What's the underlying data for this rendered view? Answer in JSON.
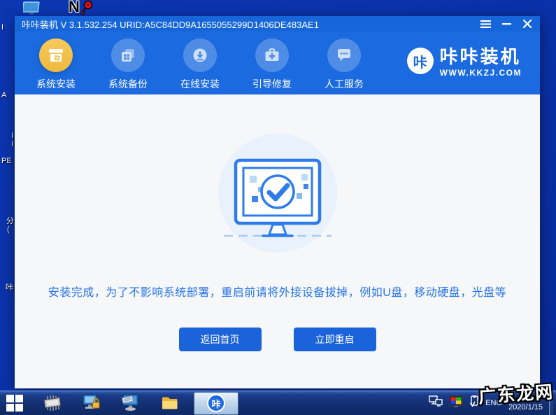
{
  "desktop": {
    "fragments": [
      "I",
      "A",
      "I",
      "I",
      "PE",
      "分",
      "(",
      "咔"
    ]
  },
  "window": {
    "titlebar": {
      "title": "咔咔装机 V 3.1.532.254 URID:A5C84DD9A1655055299D1406DE483AE1"
    },
    "nav": {
      "items": [
        {
          "label": "系统安装",
          "icon": "install-box-icon",
          "active": true
        },
        {
          "label": "系统备份",
          "icon": "backup-icon",
          "active": false
        },
        {
          "label": "在线安装",
          "icon": "download-icon",
          "active": false
        },
        {
          "label": "引导修复",
          "icon": "repair-kit-icon",
          "active": false
        },
        {
          "label": "人工服务",
          "icon": "chat-service-icon",
          "active": false
        }
      ],
      "logo": {
        "badge": "咔",
        "title": "咔咔装机",
        "url": "WWW.KKZJ.COM"
      }
    },
    "content": {
      "message": "安装完成，为了不影响系统部署，重启前请将外接设备拔掉，例如U盘，移动硬盘，光盘等",
      "home_button": "返回首页",
      "restart_button": "立即重启"
    }
  },
  "taskbar": {
    "kaka_badge": "咔",
    "tray": {
      "language": "ENG",
      "date": "2020/1/15"
    }
  },
  "watermark": "广东龙网",
  "colors": {
    "desktop_blue": "#0a31a8",
    "header_blue": "#1b6adf",
    "accent_gold": "#eeb93e",
    "button_blue": "#1b63da",
    "message_blue": "#2673e8",
    "content_bg": "#f6f7f8",
    "taskbar_blue": "#132f72"
  }
}
